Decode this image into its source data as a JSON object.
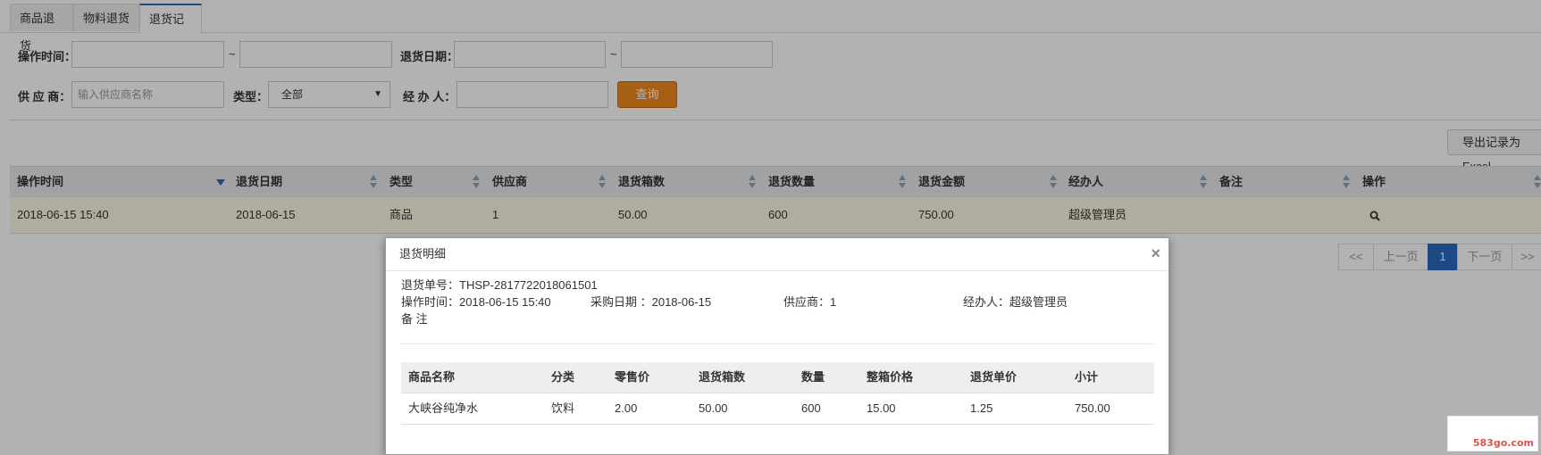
{
  "tabs": [
    {
      "label": "商品退货"
    },
    {
      "label": "物料退货"
    },
    {
      "label": "退货记录"
    }
  ],
  "filters": {
    "op_time_label": "操作时间：",
    "return_date_label": "退货日期：",
    "tilde": "~",
    "supplier_label": "供 应 商：",
    "supplier_placeholder": "输入供应商名称",
    "type_label": "类型：",
    "type_value": "全部",
    "handler_label": "经 办 人：",
    "query_button": "查询"
  },
  "export_button": "导出记录为Excel",
  "table": {
    "headers": [
      "操作时间",
      "退货日期",
      "类型",
      "供应商",
      "退货箱数",
      "退货数量",
      "退货金额",
      "经办人",
      "备注",
      "操作"
    ],
    "rows": [
      [
        "2018-06-15 15:40",
        "2018-06-15",
        "商品",
        "1",
        "50.00",
        "600",
        "750.00",
        "超级管理员",
        ""
      ]
    ]
  },
  "pagination": {
    "first": "<<",
    "prev": "上一页",
    "current": "1",
    "next": "下一页",
    "last": ">>"
  },
  "modal": {
    "title": "退货明细",
    "close": "×",
    "order_no": "退货单号：THSP-2817722018061501",
    "op_time": "操作时间：2018-06-15 15:40",
    "purchase_date": "采购日期 ：2018-06-15",
    "supplier": "供应商：1",
    "handler": "经办人：超级管理员",
    "remark": "备 注",
    "detail": {
      "headers": [
        "商品名称",
        "分类",
        "零售价",
        "退货箱数",
        "数量",
        "整箱价格",
        "退货单价",
        "小计"
      ],
      "rows": [
        [
          "大峡谷纯净水",
          "饮料",
          "2.00",
          "50.00",
          "600",
          "15.00",
          "1.25",
          "750.00"
        ]
      ]
    }
  },
  "watermark": "583go.com",
  "colors": {
    "accent": "#2a6bbf",
    "query_button": "#ef8a1c",
    "selected_row": "#fcf8e3"
  }
}
